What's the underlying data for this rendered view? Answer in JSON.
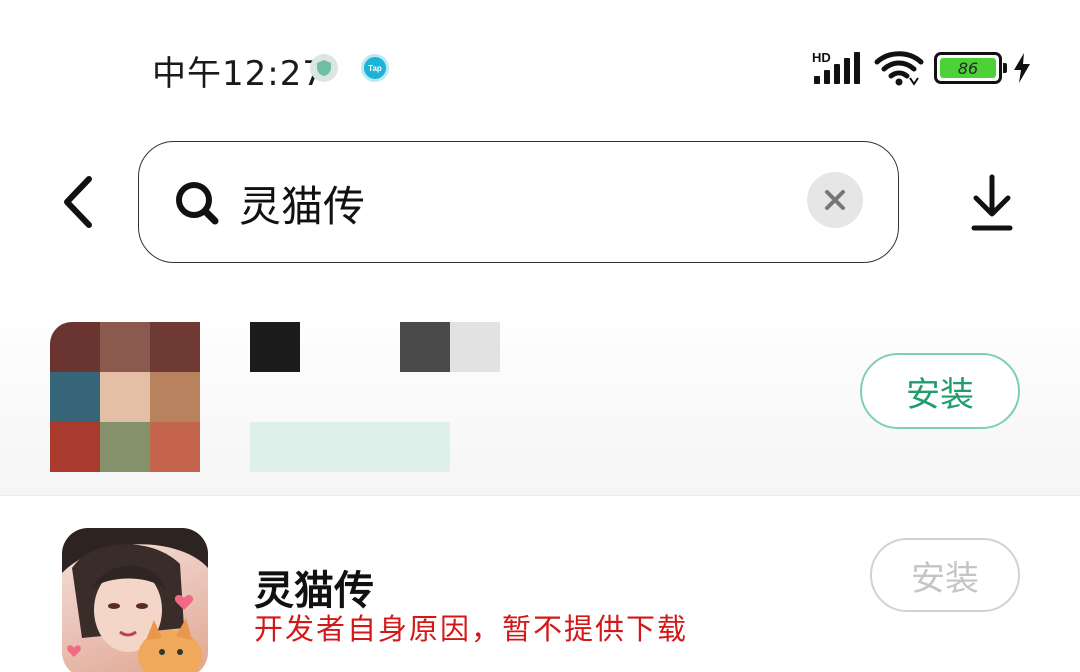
{
  "status_bar": {
    "time": "中午12:27",
    "network_label": "HD",
    "battery_level": "86",
    "icons": [
      "shield-icon",
      "taptap-icon",
      "signal-icon",
      "wifi-icon",
      "battery-icon",
      "charging-bolt-icon"
    ],
    "tap_badge": "Tap"
  },
  "header": {
    "back_icon": "chevron-left-icon",
    "search": {
      "value": "灵猫传",
      "icon": "search-icon",
      "clear_icon": "close-icon"
    },
    "download_icon": "download-icon"
  },
  "results": [
    {
      "pixelated": true,
      "install_label": "安装",
      "install_color": "#1e9d6d",
      "install_border": "#7fd0b2"
    },
    {
      "title": "灵猫传",
      "note": "开发者自身原因，暂不提供下载",
      "note_color": "#d21818",
      "install_label": "安装",
      "install_color": "#c5c5c5"
    }
  ]
}
